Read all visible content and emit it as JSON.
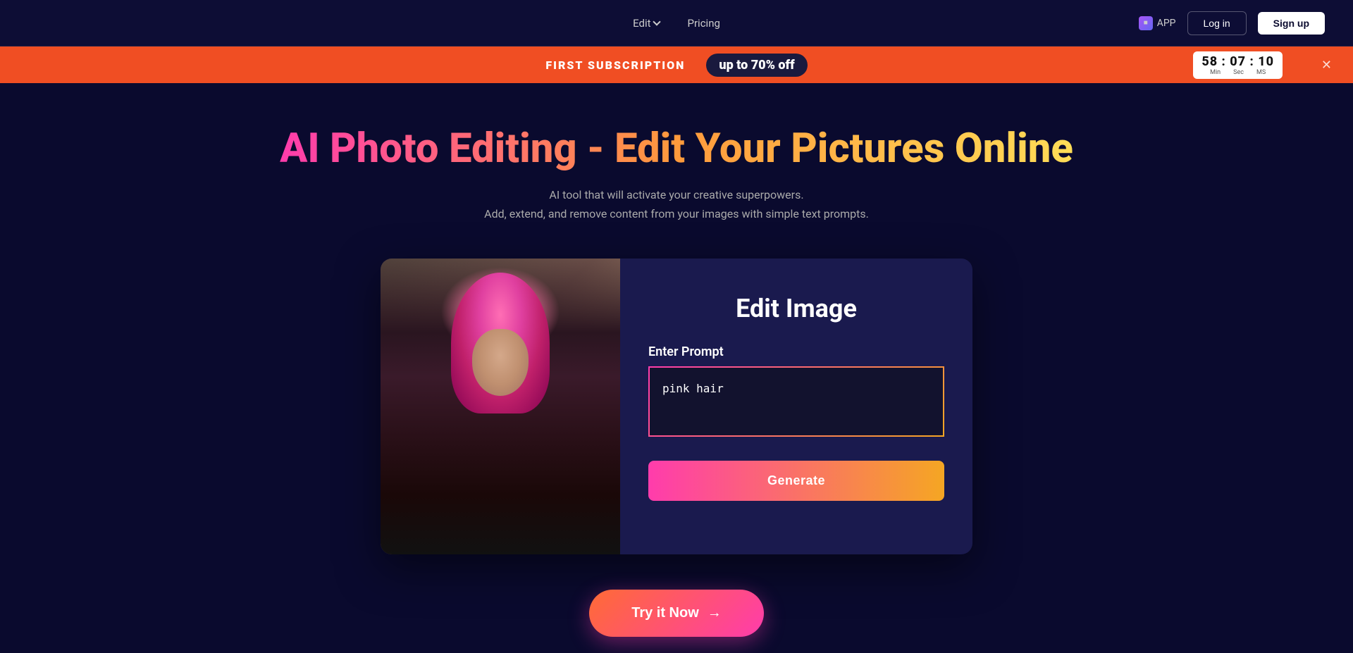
{
  "nav": {
    "edit_label": "Edit",
    "pricing_label": "Pricing",
    "app_label": "APP",
    "login_label": "Log in",
    "signup_label": "Sign up"
  },
  "promo": {
    "subscription_text": "FIRST SUBSCRIPTION",
    "offer_prefix": "up to ",
    "offer_amount": "70%",
    "offer_suffix": " off",
    "timer_display": "58 : 07 : 10",
    "timer_min": "Min",
    "timer_sec": "Sec",
    "timer_ms": "MS"
  },
  "hero": {
    "title": "AI Photo Editing - Edit Your Pictures Online",
    "subtitle_line1": "AI tool that will activate your creative superpowers.",
    "subtitle_line2": "Add, extend, and remove content from your images with simple text prompts."
  },
  "card": {
    "panel_title": "Edit Image",
    "prompt_label": "Enter Prompt",
    "prompt_value": "pink hair",
    "generate_label": "Generate"
  },
  "try_button": {
    "label": "Try it Now",
    "arrow": "→"
  }
}
